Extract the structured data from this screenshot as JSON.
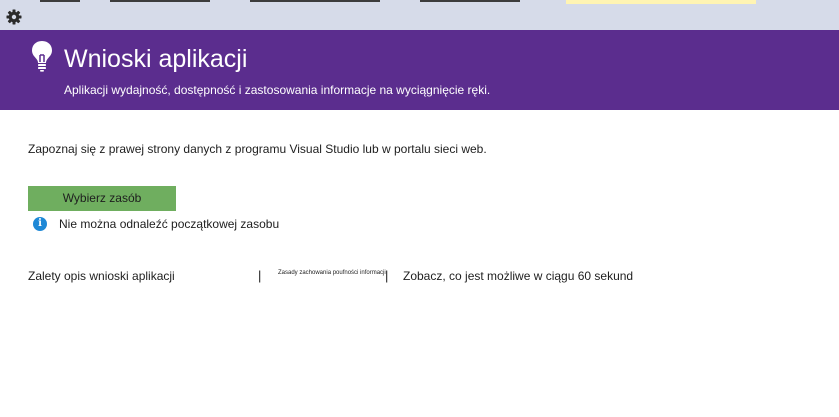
{
  "app": {
    "accent_color": "#5b2d8e",
    "toolbar_color": "#d6dbe9",
    "button_color": "#6fae5f",
    "info_color": "#1e88d6"
  },
  "toolbar": {
    "settings_icon": "gear-icon"
  },
  "banner": {
    "icon": "lightbulb-icon",
    "title": "Wnioski aplikacji",
    "subtitle": "Aplikacji wydajność, dostępność i zastosowania informacje na wyciągnięcie ręki."
  },
  "main": {
    "intro": "Zapoznaj się z prawej strony danych z programu Visual Studio lub w portalu sieci web.",
    "select_button": "Wybierz zasób",
    "info_icon": "info-icon",
    "info_message": "Nie można odnaleźć początkowej zasobu"
  },
  "links": {
    "overview": "Zalety opis wnioski aplikacji",
    "privacy": "Zasady zachowania poufności informacji",
    "sixty_seconds": "Zobacz, co jest możliwe w ciągu 60 sekund",
    "separator": "|"
  }
}
